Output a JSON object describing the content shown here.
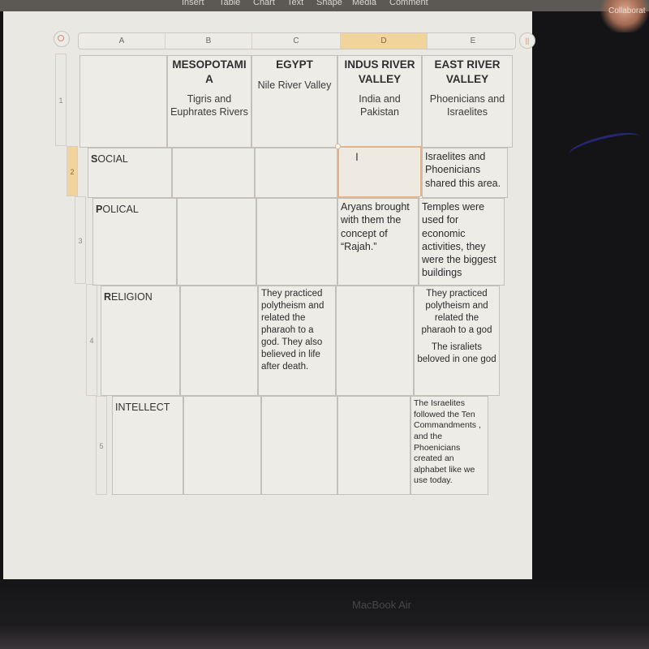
{
  "toolbar": {
    "items": [
      "Insert",
      "Table",
      "Chart",
      "Text",
      "Shape",
      "Media",
      "Comment"
    ],
    "collaborate_label": "Collaborat"
  },
  "device": {
    "brand_label": "MacBook Air"
  },
  "sheet": {
    "column_headers": [
      "A",
      "B",
      "C",
      "D",
      "E"
    ],
    "selected_column": "D",
    "row_headers": [
      "1",
      "2",
      "3",
      "4",
      "5"
    ],
    "selected_row": "2",
    "pause_icon": "||"
  },
  "table": {
    "header_row": {
      "corner": "",
      "civilizations": [
        {
          "title": "MESOPOTAMI A",
          "subtitle": "Tigris and Euphrates Rivers"
        },
        {
          "title": "EGYPT",
          "subtitle": "Nile River Valley"
        },
        {
          "title": "INDUS RIVER VALLEY",
          "subtitle": "India and Pakistan"
        },
        {
          "title": "EAST RIVER VALLEY",
          "subtitle": "Phoenicians and Israelites"
        }
      ]
    },
    "rows": [
      {
        "label_initial": "S",
        "label_rest": "OCIAL",
        "cells": [
          "",
          "",
          "",
          "Israelites and Phoenicians shared this area."
        ]
      },
      {
        "label_initial": "P",
        "label_rest": "OLICAL",
        "cells": [
          "",
          "",
          "Aryans brought with them the concept of “Rajah.”",
          "Temples were used for economic activities, they were the biggest buildings"
        ]
      },
      {
        "label_initial": "R",
        "label_rest": "ELIGION",
        "cells": [
          "",
          "They practiced polytheism and related the pharaoh to a god. They also believed in life after death.",
          "",
          "They practiced polytheism and related the pharaoh to a god"
        ],
        "extra_e": "The israliets beloved in one god"
      },
      {
        "label_initial": "",
        "label_rest": "INTELLECT",
        "cells": [
          "",
          "",
          "",
          "The Israelites followed the Ten Commandments , and the Phoenicians created an alphabet like we use today."
        ]
      }
    ]
  },
  "active_cell": {
    "ref": "D2",
    "cursor_glyph": "I"
  }
}
